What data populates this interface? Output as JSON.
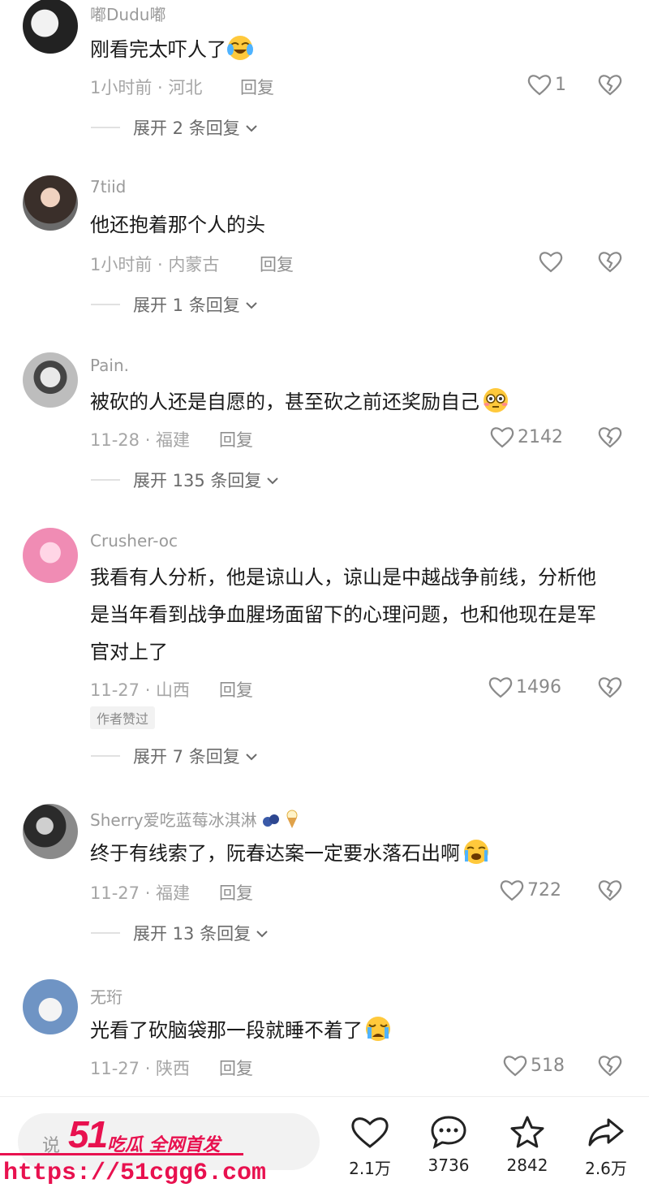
{
  "comments": [
    {
      "username": "嘟Dudu嘟",
      "text": "刚看完太吓人了",
      "emoji": "crying-laugh-emoji",
      "time_location": "1小时前 · 河北",
      "reply_label": "回复",
      "likes": "1",
      "expand_label": "展开 2 条回复"
    },
    {
      "username": "7tiid",
      "text": "他还抱着那个人的头",
      "time_location": "1小时前 · 内蒙古",
      "reply_label": "回复",
      "likes": "",
      "expand_label": "展开 1 条回复"
    },
    {
      "username": "Pain.",
      "text": "被砍的人还是自愿的，甚至砍之前还奖励自己",
      "emoji": "flushed-emoji",
      "time_location": "11-28 · 福建",
      "reply_label": "回复",
      "likes": "2142",
      "expand_label": "展开 135 条回复"
    },
    {
      "username": "Crusher-oc",
      "text": "我看有人分析，他是谅山人，谅山是中越战争前线，分析他是当年看到战争血腥场面留下的心理问题，也和他现在是军官对上了",
      "time_location": "11-27 · 山西",
      "reply_label": "回复",
      "likes": "1496",
      "author_tag": "作者赞过",
      "expand_label": "展开 7 条回复"
    },
    {
      "username": "Sherry爱吃蓝莓冰淇淋",
      "text": "终于有线索了，阮春达案一定要水落石出啊",
      "emoji": "crying-emoji",
      "time_location": "11-27 · 福建",
      "reply_label": "回复",
      "likes": "722",
      "expand_label": "展开 13 条回复"
    },
    {
      "username": "无珩",
      "text": "光看了砍脑袋那一段就睡不着了",
      "emoji": "sob-emoji",
      "time_location": "11-27 · 陕西",
      "reply_label": "回复",
      "likes": "518"
    }
  ],
  "bottom_bar": {
    "input_placeholder": "说",
    "likes": "2.1万",
    "comments": "3736",
    "favorites": "2842",
    "shares": "2.6万"
  },
  "watermark": {
    "logo": "51",
    "slogan": "吃瓜 全网首发",
    "url": "https://51cgg6.com"
  },
  "colors": {
    "accent_watermark": "#e8114f",
    "meta_gray": "#a6a6a6",
    "text": "#1a1a1a"
  }
}
